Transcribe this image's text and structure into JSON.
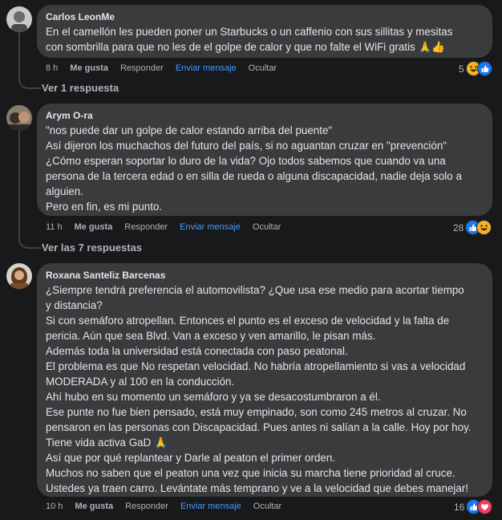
{
  "comments": [
    {
      "author": "Carlos LeonMe",
      "lines": [
        "En el camellón les pueden poner un Starbucks o un caffenio con sus sillitas y mesitas",
        "con sombrilla para que no les de el golpe de calor y que no falte el WiFi gratis 🙏👍"
      ],
      "time": "8 h",
      "like": "Me gusta",
      "reply": "Responder",
      "send": "Enviar mensaje",
      "hide": "Ocultar",
      "reaction_count": "5",
      "reactions": [
        "haha-icon",
        "like-icon"
      ],
      "replies_label": "Ver 1 respuesta"
    },
    {
      "author": "Arym O-ra",
      "lines": [
        "\"nos puede dar un golpe de calor estando arriba del puente\"",
        "Así dijeron los muchachos del futuro del país, si no aguantan cruzar en \"prevención\"",
        "¿Cómo esperan soportar lo duro de la vida? Ojo todos sabemos que cuando va una",
        "persona de la tercera edad o en silla de rueda o alguna discapacidad, nadie deja solo a",
        "alguien.",
        "Pero en fin, es mi punto."
      ],
      "time": "11 h",
      "like": "Me gusta",
      "reply": "Responder",
      "send": "Enviar mensaje",
      "hide": "Ocultar",
      "reaction_count": "28",
      "reactions": [
        "like-icon",
        "haha-icon"
      ],
      "replies_label": "Ver las 7 respuestas"
    },
    {
      "author": "Roxana Santeliz Barcenas",
      "lines": [
        "¿Siempre tendrá preferencia el automovilista? ¿Que usa ese medio para acortar tiempo",
        "y distancia?",
        "Si con semáforo atropellan. Entonces el punto es el exceso de velocidad y la falta de",
        "pericia. Aún que sea Blvd. Van a exceso y ven amarillo, le pisan más.",
        "Además toda la universidad está conectada con paso peatonal.",
        "El problema es que No respetan velocidad. No habría atropellamiento si vas a velocidad",
        "MODERADA y al 100 en la conducción.",
        "Ahí hubo en su momento un semáforo y ya se desacostumbraron a él.",
        "Ese punte no fue bien pensado, está muy empinado, son como 245 metros al cruzar. No",
        "pensaron en las personas con Discapacidad. Pues antes ni salían a la calle. Hoy por hoy.",
        "Tiene vida activa GaD 🙏",
        "Así que por qué replantear y Darle al peaton el primer orden.",
        "Muchos no saben que el peaton una vez que inicia su marcha tiene prioridad al cruce.",
        "Ustedes ya traen carro. Levántate más temprano y ve a la velocidad que debes manejar!"
      ],
      "time": "10 h",
      "like": "Me gusta",
      "reply": "Responder",
      "send": "Enviar mensaje",
      "hide": "Ocultar",
      "reaction_count": "16",
      "reactions": [
        "like-icon",
        "love-icon"
      ]
    }
  ],
  "colors": {
    "background": "#18191a",
    "bubble": "#3a3b3c",
    "link_blue": "#4599ff",
    "like_blue": "#1877f2",
    "love_red": "#f33e58",
    "haha_yellow": "#f7b125"
  }
}
